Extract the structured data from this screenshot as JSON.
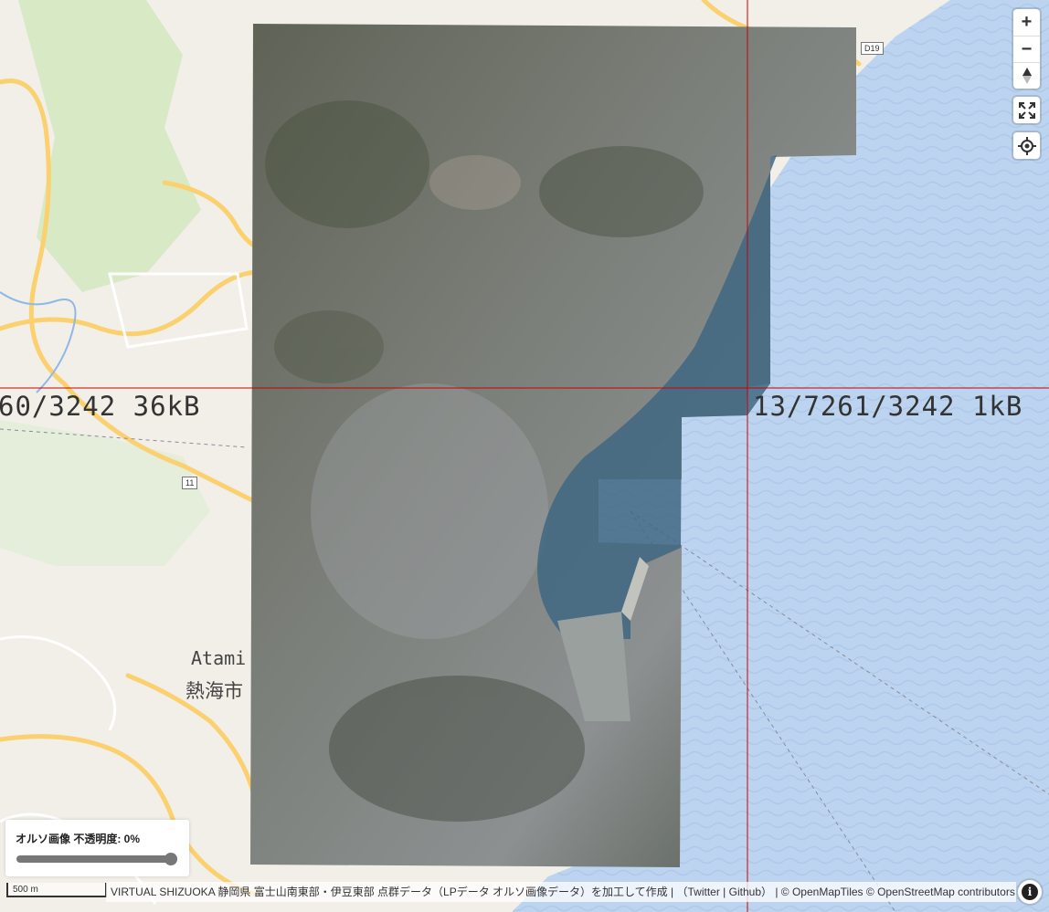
{
  "map": {
    "tile_labels": {
      "left": "60/3242 36kB",
      "right": "13/7261/3242 1kB"
    },
    "place_names": {
      "en": "Atami",
      "ja": "熱海市"
    },
    "road_shields": {
      "r11": "11",
      "d19": "D19"
    }
  },
  "controls": {
    "zoom_in": "+",
    "zoom_out": "−",
    "compass": "▲",
    "fullscreen": "⛶",
    "locate": "◎"
  },
  "opacity_panel": {
    "label": "オルソ画像 不透明度: 0%",
    "value_percent": 0
  },
  "scale_bar": {
    "label": "500 m"
  },
  "attribution": {
    "text": "VIRTUAL SHIZUOKA 静岡県 富士山南東部・伊豆東部 点群データ（LPデータ オルソ画像データ）を加工して作成 |",
    "twitter": "Twitter",
    "separator1": "|",
    "github": "Github",
    "suffix": "| © OpenMapTiles © OpenStreetMap contributors"
  },
  "colors": {
    "sea": "#bcd4ef",
    "land": "#f2efe9",
    "forest": "#c8e0b2",
    "road_major": "#fbd06e",
    "tile_border": "#cc0000"
  }
}
